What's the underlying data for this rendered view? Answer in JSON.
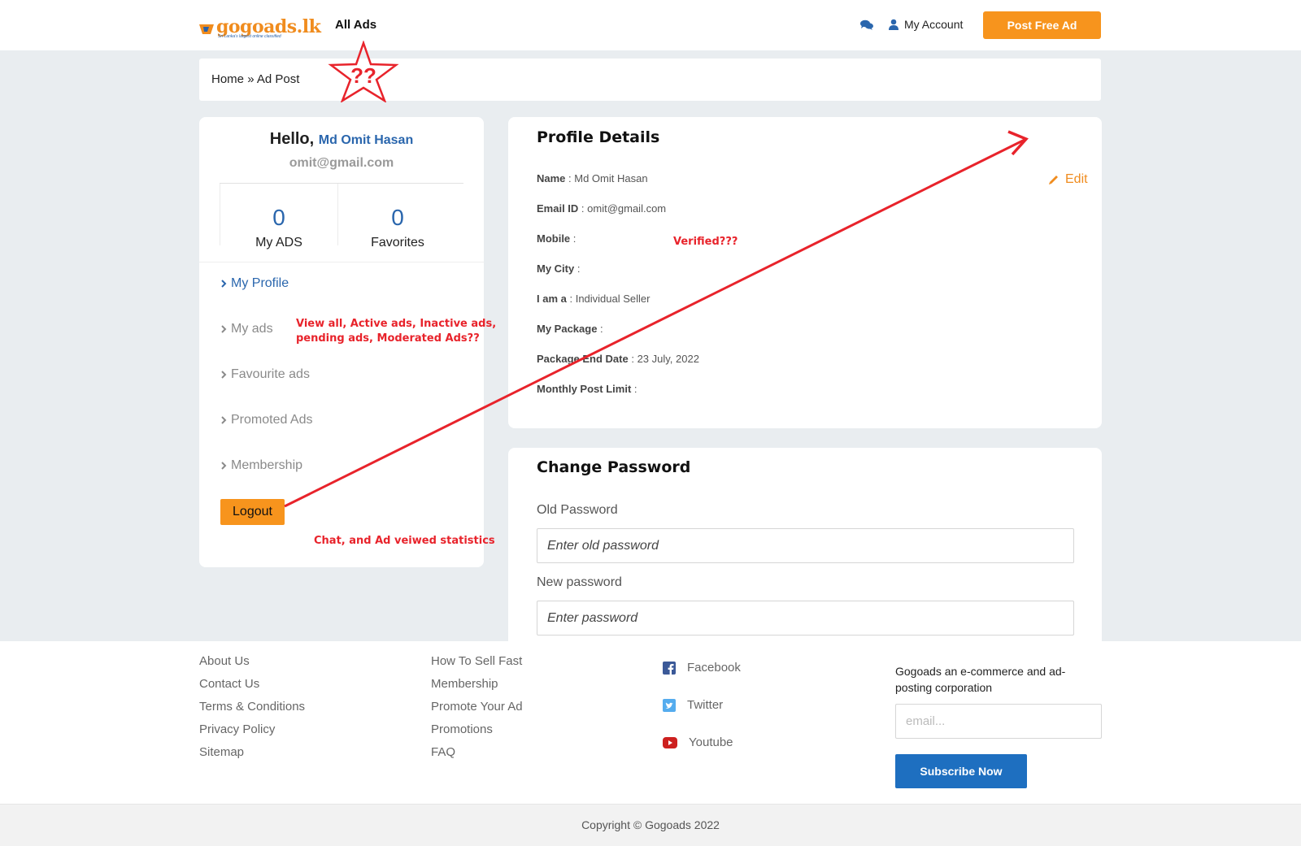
{
  "header": {
    "logo_text": "gogoads",
    "logo_tld": ".lk",
    "logo_tagline": "Sri Lanka's largest online classified",
    "nav_all_ads": "All Ads",
    "my_account": "My Account",
    "post_free_ad": "Post Free Ad"
  },
  "breadcrumb": {
    "home": "Home",
    "separator": "»",
    "current": "Ad Post"
  },
  "annotations": {
    "star_text": "??",
    "verified_note": "Verified???",
    "my_ads_note_line1": "View all, Active ads, Inactive ads,",
    "my_ads_note_line2": "pending ads, Moderated Ads??",
    "stats_note": "Chat, and Ad veiwed statistics",
    "color": "#e8232b"
  },
  "user_card": {
    "hello": "Hello,",
    "name": "Md Omit Hasan",
    "email": "omit@gmail.com",
    "stats": [
      {
        "value": "0",
        "label": "My ADS"
      },
      {
        "value": "0",
        "label": "Favorites"
      }
    ],
    "menu": [
      {
        "label": "My Profile",
        "active": true
      },
      {
        "label": "My ads",
        "active": false
      },
      {
        "label": "Favourite ads",
        "active": false
      },
      {
        "label": "Promoted Ads",
        "active": false
      },
      {
        "label": "Membership",
        "active": false
      }
    ],
    "logout": "Logout"
  },
  "profile": {
    "title": "Profile Details",
    "edit": "Edit",
    "fields": [
      {
        "label": "Name",
        "value": "Md Omit Hasan"
      },
      {
        "label": "Email ID",
        "value": "omit@gmail.com"
      },
      {
        "label": "Mobile",
        "value": ""
      },
      {
        "label": "My City",
        "value": ""
      },
      {
        "label": "I am a",
        "value": "Individual Seller"
      },
      {
        "label": "My Package",
        "value": ""
      },
      {
        "label": "Package End Date",
        "value": "23 July, 2022"
      },
      {
        "label": "Monthly Post Limit",
        "value": ""
      }
    ]
  },
  "password": {
    "title": "Change Password",
    "old_label": "Old Password",
    "old_placeholder": "Enter old password",
    "new_label": "New password",
    "new_placeholder": "Enter password"
  },
  "footer": {
    "col1": [
      "About Us",
      "Contact Us",
      "Terms & Conditions",
      "Privacy Policy",
      "Sitemap"
    ],
    "col2": [
      "How To Sell Fast",
      "Membership",
      "Promote Your Ad",
      "Promotions",
      "FAQ"
    ],
    "social": [
      {
        "label": "Facebook",
        "icon": "facebook-icon"
      },
      {
        "label": "Twitter",
        "icon": "twitter-icon"
      },
      {
        "label": "Youtube",
        "icon": "youtube-icon"
      }
    ],
    "tagline": "Gogoads an e-commerce and ad-posting corporation",
    "email_placeholder": "email...",
    "subscribe": "Subscribe Now",
    "copyright": "Copyright © Gogoads 2022"
  },
  "colors": {
    "brand_orange": "#f7941d",
    "brand_blue": "#2a66ad",
    "subscribe_blue": "#1e6fc0",
    "band_gray": "#e9edf0"
  }
}
